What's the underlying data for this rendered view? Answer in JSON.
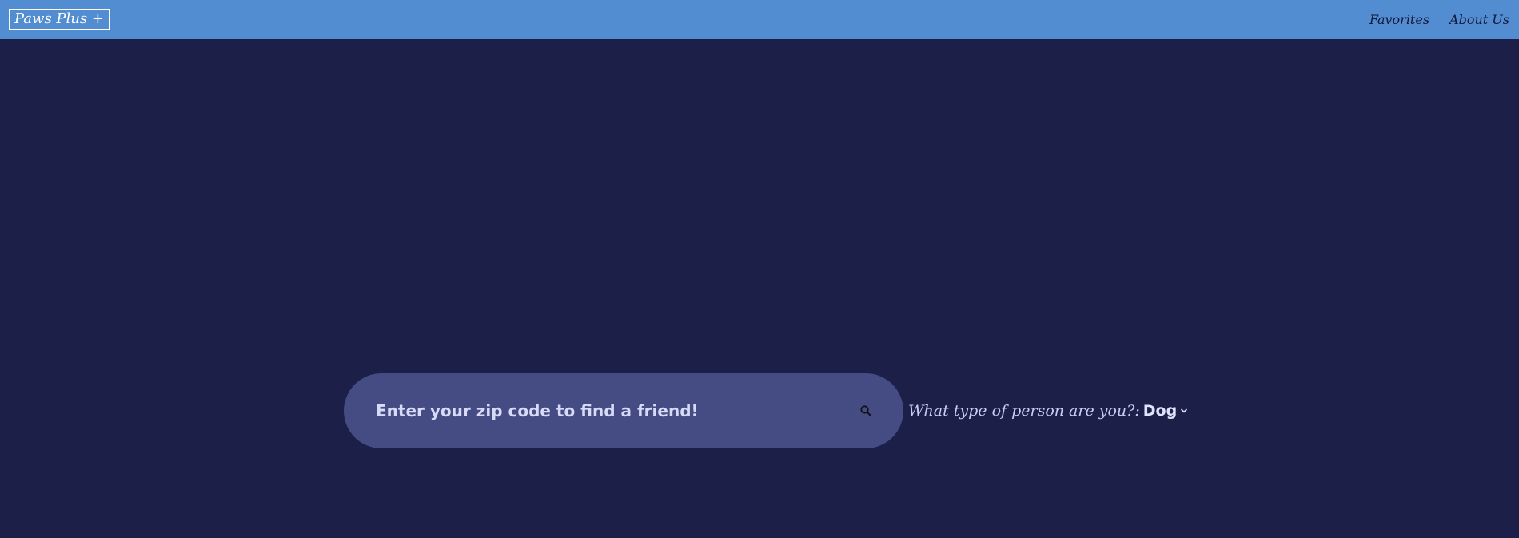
{
  "navbar": {
    "brand": "Paws Plus +",
    "links": [
      {
        "label": "Favorites"
      },
      {
        "label": "About Us"
      }
    ]
  },
  "search": {
    "placeholder": "Enter your zip code to find a friend!",
    "value": "",
    "icon": "search-icon"
  },
  "type_select": {
    "label": "What type of person are you?:",
    "selected": "Dog",
    "icon": "chevron-down-icon"
  },
  "colors": {
    "background": "#1c1f48",
    "navbar": "#528dd2",
    "search_pill": "#454b83",
    "text_light": "#d7dbf7"
  }
}
